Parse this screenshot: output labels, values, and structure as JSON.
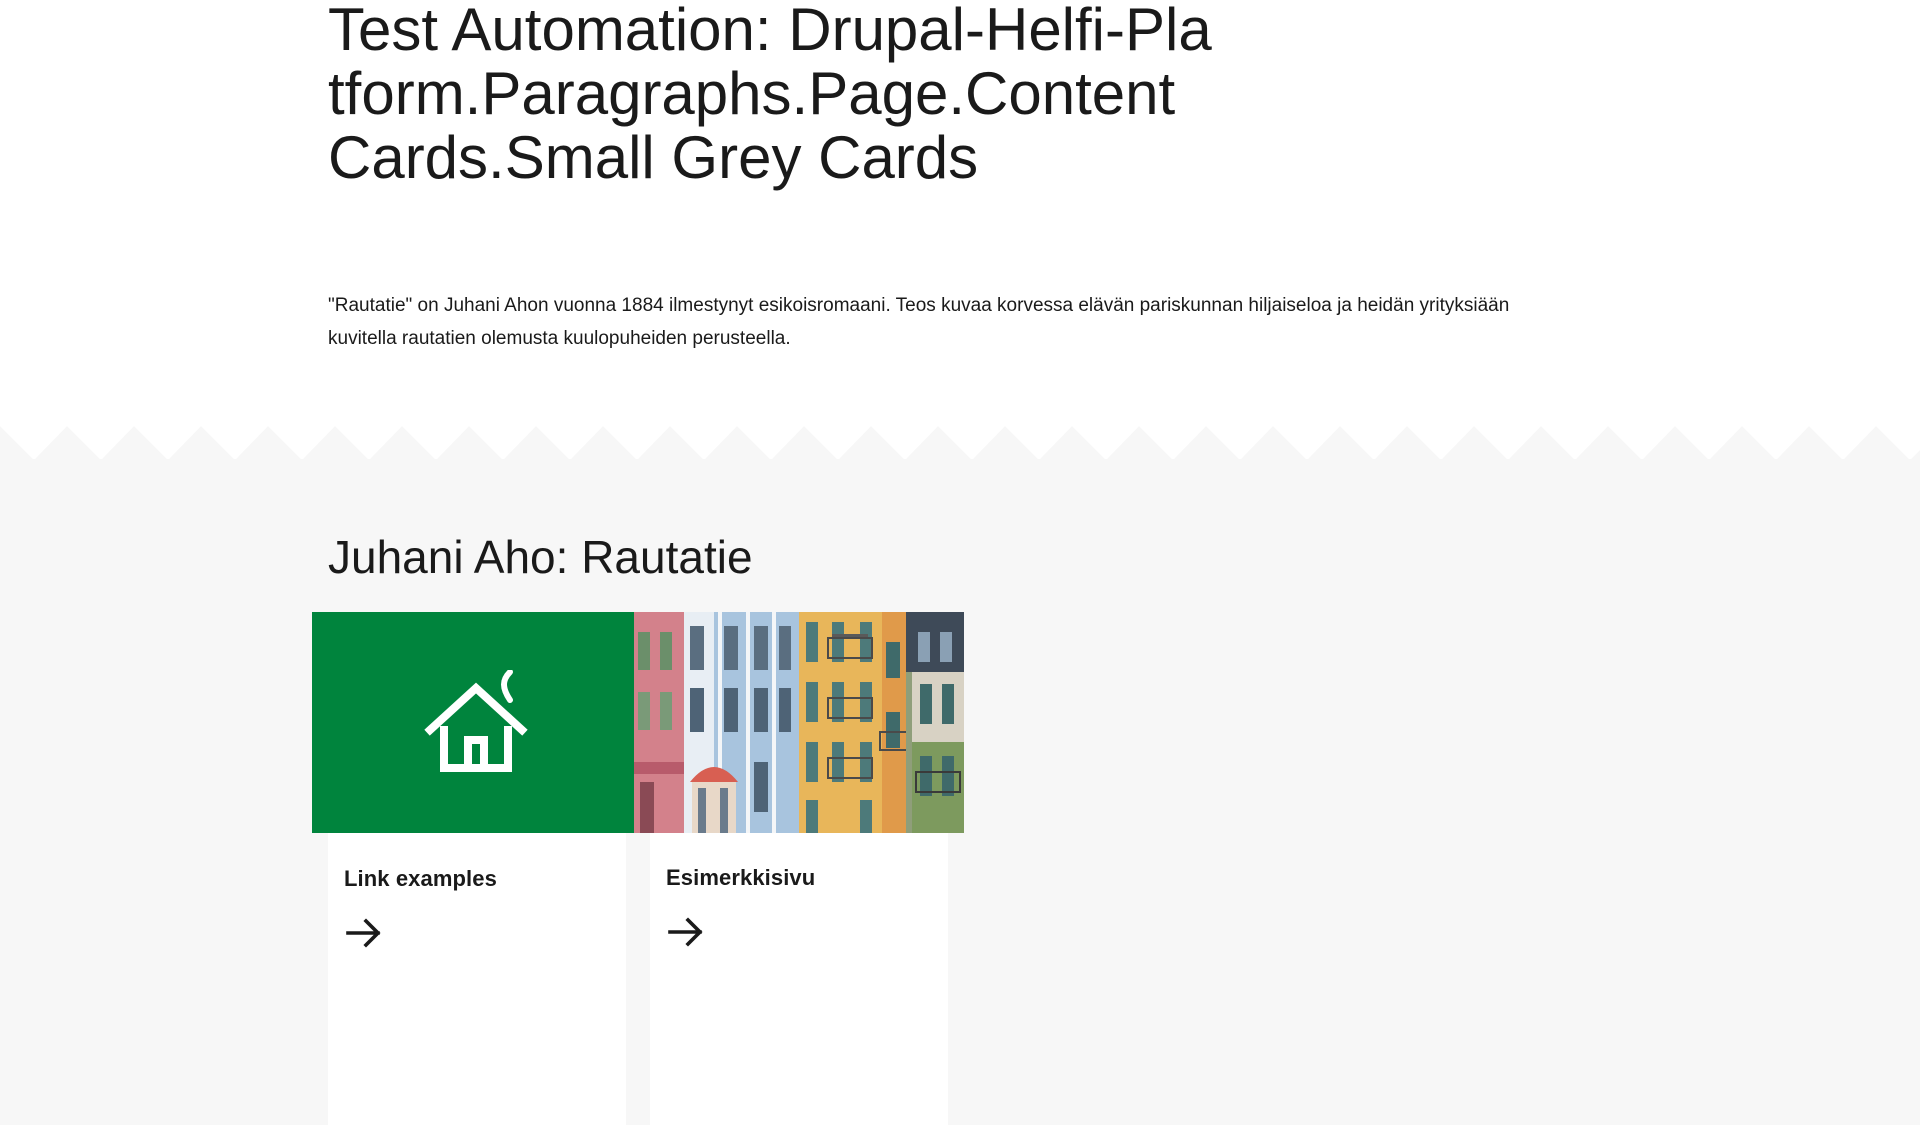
{
  "page": {
    "title": "Test Automation: Drupal-Helfi-Platform.Paragraphs.Page.Content Cards.Small Grey Cards",
    "lead": "\"Rautatie\" on Juhani Ahon vuonna 1884 ilmestynyt esikoisromaani. Teos kuvaa korvessa elävän pariskunnan hiljaiseloa ja heidän yrityksiään kuvitella rautatien olemusta kuulopuheiden perusteella."
  },
  "content_cards": {
    "title": "Juhani Aho: Rautatie",
    "cards": [
      {
        "title": "Link examples",
        "image_icon": "house-icon",
        "image_bg": "#00843d",
        "link_icon": "arrow-right-icon"
      },
      {
        "title": "Esimerkkisivu",
        "image_icon": "colorful-building-facades",
        "link_icon": "arrow-right-icon"
      }
    ]
  },
  "colors": {
    "background": "#ffffff",
    "section_background": "#f7f7f7",
    "card_background": "#ffffff",
    "brand_green": "#00843d",
    "text": "#1a1a1a"
  }
}
